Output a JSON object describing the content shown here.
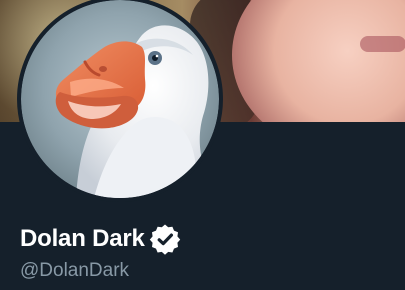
{
  "profile": {
    "display_name": "Dolan Dark",
    "handle": "@DolanDark",
    "verified_icon": "verified-badge-icon",
    "avatar_subject": "goose-avatar",
    "colors": {
      "background": "#15202b",
      "name": "#ffffff",
      "handle": "#8899a6",
      "verified_badge": "#ffffff"
    }
  }
}
